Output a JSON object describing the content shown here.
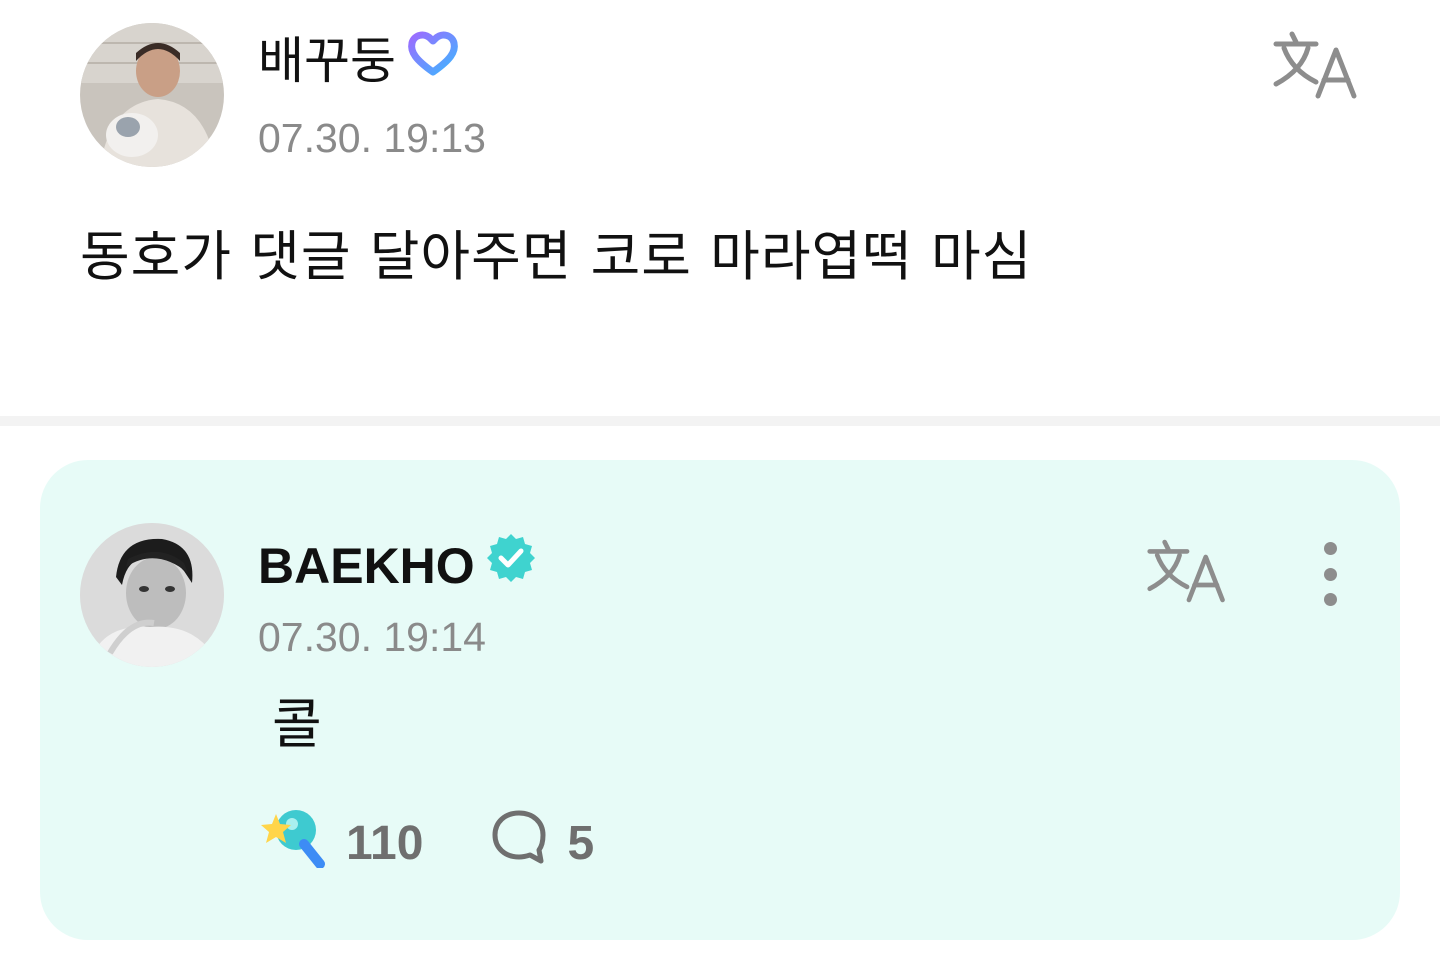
{
  "post": {
    "author_name": "배꾸둥",
    "author_badge_icon": "fan-heart-badge-icon",
    "timestamp": "07.30. 19:13",
    "text": "동호가 댓글 달아주면 코로 마라엽떡 마심",
    "translate_icon": "translate-icon"
  },
  "reply": {
    "author_name": "BAEKHO",
    "author_badge_icon": "verified-check-icon",
    "timestamp": "07.30. 19:14",
    "text": "콜",
    "translate_icon": "translate-icon",
    "more_icon": "more-vertical-icon",
    "likes": "110",
    "like_icon": "star-wand-icon",
    "comments": "5",
    "comment_icon": "comment-bubble-icon"
  },
  "colors": {
    "reply_background": "#e7fbf7",
    "verified_badge": "#3fd3cf",
    "muted_text": "#8a8a8a",
    "divider": "#f3f3f3"
  }
}
